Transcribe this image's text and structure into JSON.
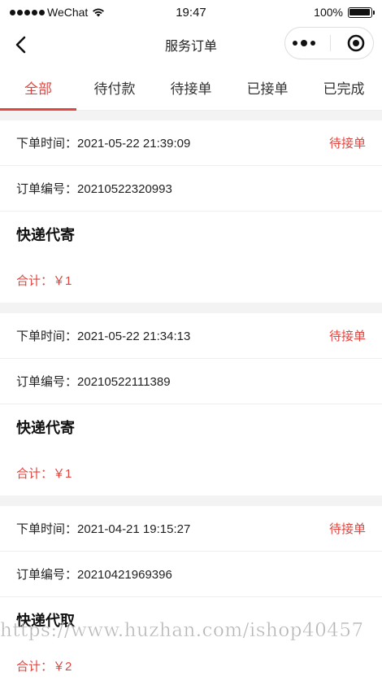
{
  "status_bar": {
    "carrier": "WeChat",
    "time": "19:47",
    "battery": "100%",
    "battery_level": 1.0
  },
  "nav": {
    "title": "服务订单"
  },
  "tabs": [
    {
      "label": "全部",
      "active": true
    },
    {
      "label": "待付款",
      "active": false
    },
    {
      "label": "待接单",
      "active": false
    },
    {
      "label": "已接单",
      "active": false
    },
    {
      "label": "已完成",
      "active": false
    }
  ],
  "orders": [
    {
      "time_label": "下单时间：",
      "time": "2021-05-22 21:39:09",
      "status": "待接单",
      "no_label": "订单编号：",
      "order_no": "20210522320993",
      "service": "快递代寄",
      "total": "合计：￥1"
    },
    {
      "time_label": "下单时间：",
      "time": "2021-05-22 21:34:13",
      "status": "待接单",
      "no_label": "订单编号：",
      "order_no": "20210522111389",
      "service": "快递代寄",
      "total": "合计：￥1"
    },
    {
      "time_label": "下单时间：",
      "time": "2021-04-21 19:15:27",
      "status": "待接单",
      "no_label": "订单编号：",
      "order_no": "20210421969396",
      "service": "快递代取",
      "total": "合计：￥2"
    }
  ],
  "watermark": "https://www.huzhan.com/ishop40457",
  "colors": {
    "accent": "#e0453f",
    "background": "#f3f3f3"
  }
}
